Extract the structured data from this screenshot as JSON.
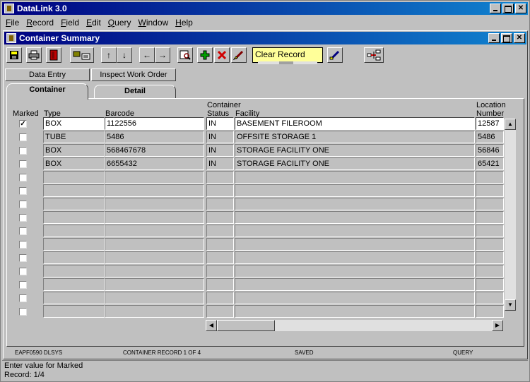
{
  "app": {
    "title": "DataLink 3.0"
  },
  "menu": [
    "File",
    "Record",
    "Field",
    "Edit",
    "Query",
    "Window",
    "Help"
  ],
  "child_window": {
    "title": "Container Summary"
  },
  "toolbar": {
    "clear_record_value": "Clear Record"
  },
  "buttons": {
    "data_entry": "Data Entry",
    "inspect_work_order": "Inspect Work Order"
  },
  "tabs": [
    "Container",
    "Detail"
  ],
  "columns": {
    "marked": "Marked",
    "type": "Type",
    "barcode": "Barcode",
    "status_top": "Container",
    "status_bottom": "Status",
    "facility": "Facility",
    "location_top": "Location",
    "location_bottom": "Number"
  },
  "rows": [
    {
      "marked": true,
      "type": "BOX",
      "barcode": "1122556",
      "status": "IN",
      "facility": "BASEMENT FILEROOM",
      "location": "12587"
    },
    {
      "marked": false,
      "type": "TUBE",
      "barcode": "5486",
      "status": "IN",
      "facility": "OFFSITE STORAGE 1",
      "location": "5486"
    },
    {
      "marked": false,
      "type": "BOX",
      "barcode": "568467678",
      "status": "IN",
      "facility": "STORAGE FACILITY ONE",
      "location": "56846"
    },
    {
      "marked": false,
      "type": "BOX",
      "barcode": "6655432",
      "status": "IN",
      "facility": "STORAGE FACILITY ONE",
      "location": "65421"
    }
  ],
  "empty_rows": 11,
  "status_bar": {
    "user": "EAPF0590 DLSYS",
    "record_info": "CONTAINER RECORD 1 OF 4",
    "save_state": "SAVED",
    "mode": "QUERY"
  },
  "message": {
    "line1": "Enter value for Marked",
    "line2": "Record: 1/4"
  },
  "colors": {
    "title_start": "#000080",
    "title_end": "#1084d0",
    "clear_record_bg": "#ffff99"
  }
}
